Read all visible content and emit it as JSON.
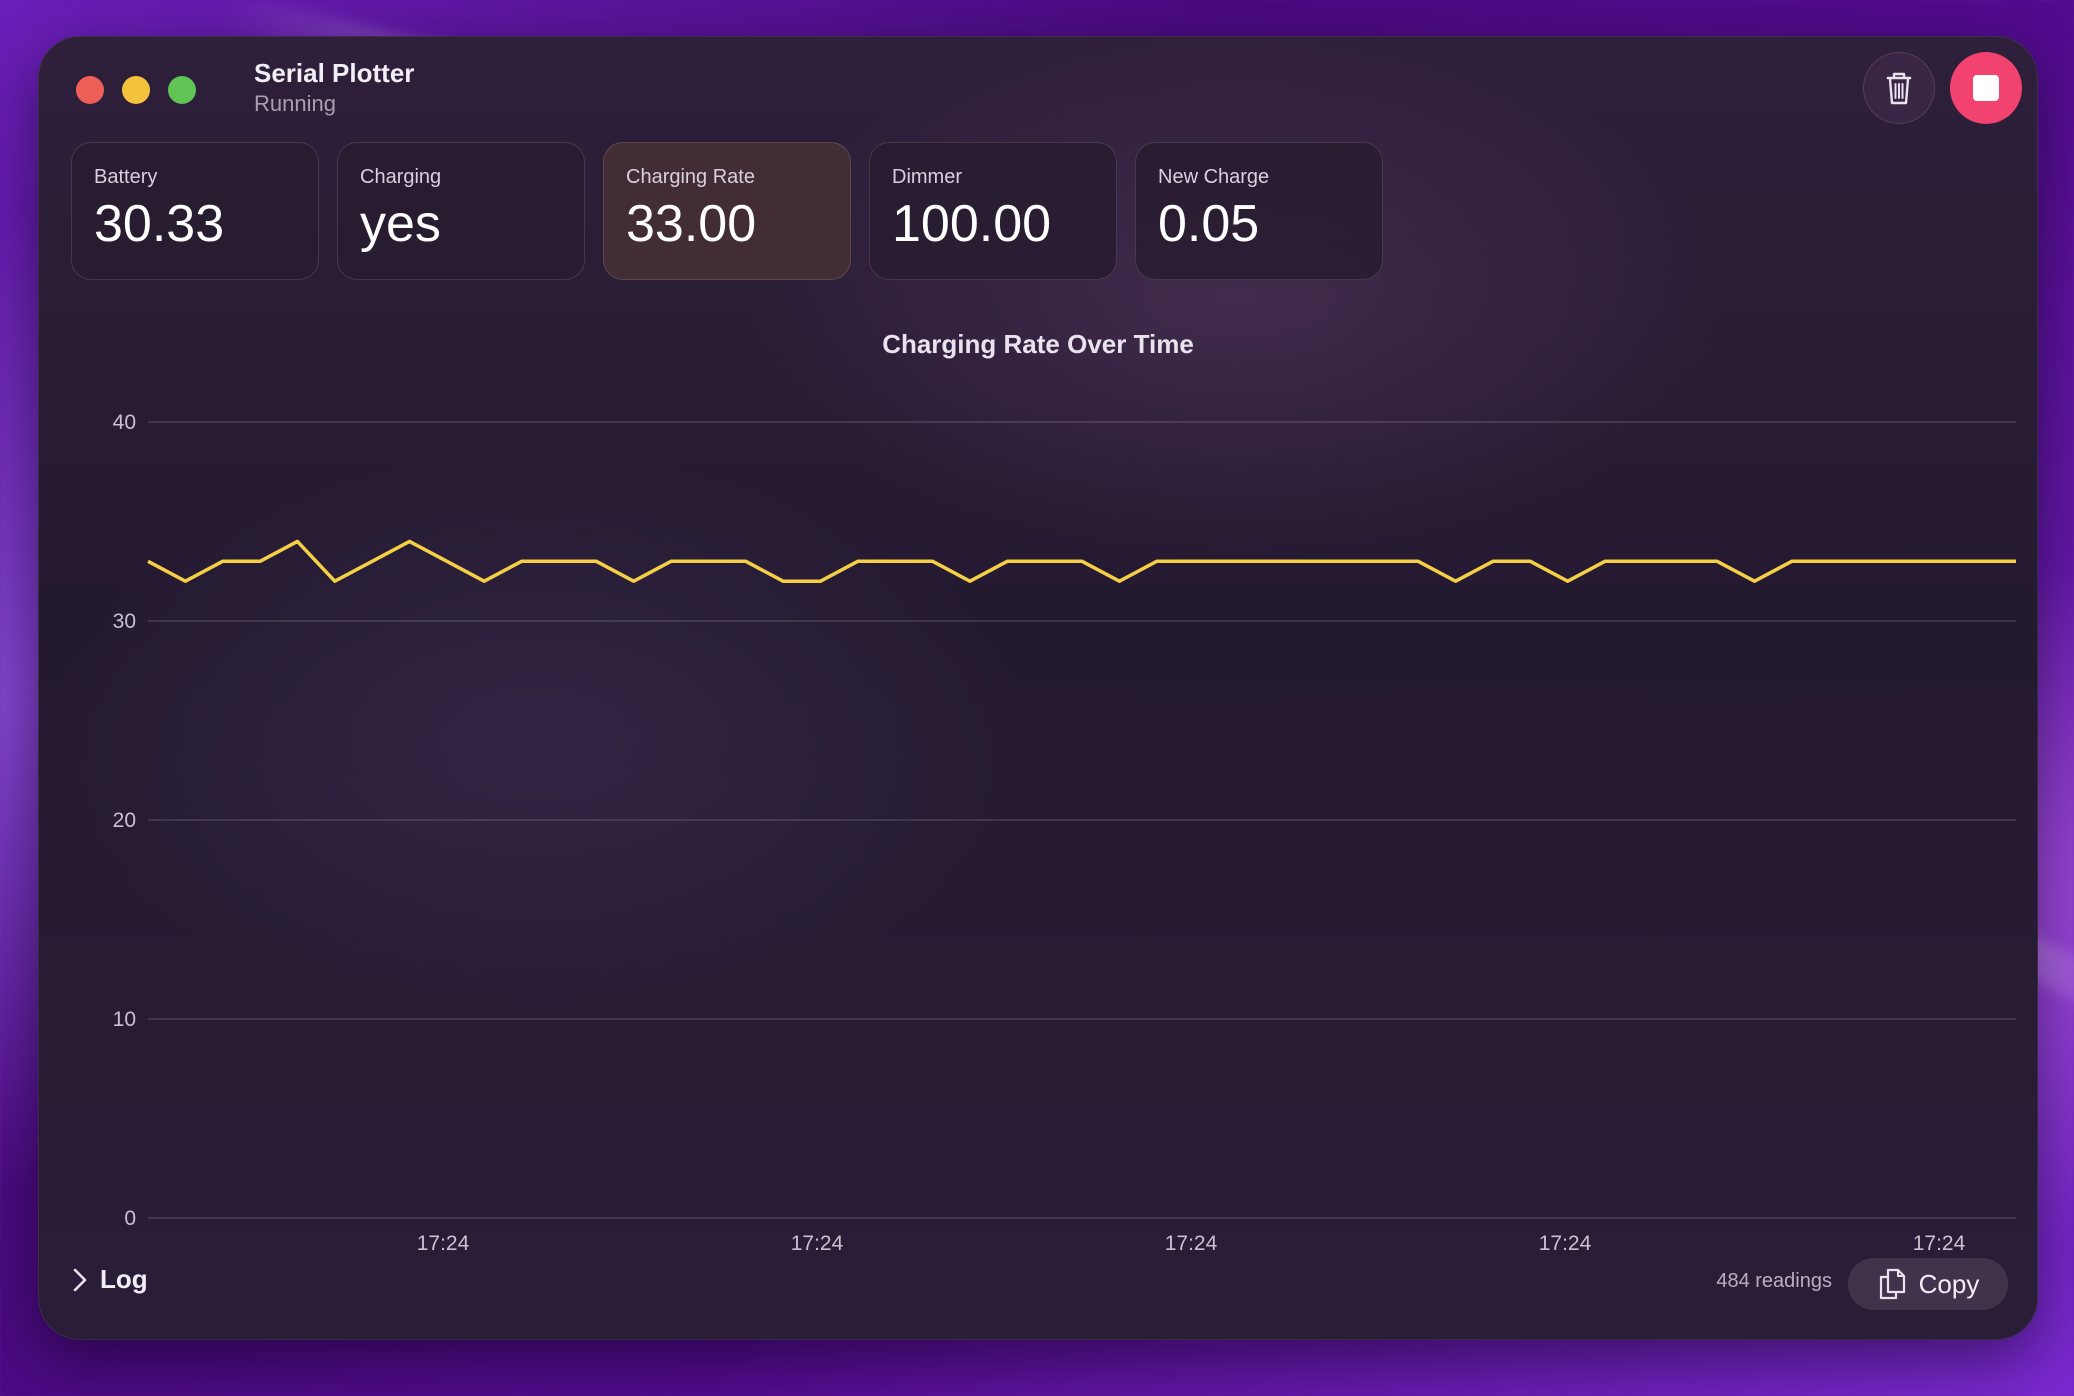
{
  "window": {
    "title": "Serial Plotter",
    "status": "Running"
  },
  "controls": {
    "clear_icon": "trash-icon",
    "stop_icon": "stop-icon",
    "stop_color": "#f2426f"
  },
  "cards": [
    {
      "label": "Battery",
      "value": "30.33"
    },
    {
      "label": "Charging",
      "value": "yes"
    },
    {
      "label": "Charging Rate",
      "value": "33.00",
      "selected": true
    },
    {
      "label": "Dimmer",
      "value": "100.00"
    },
    {
      "label": "New Charge",
      "value": "0.05"
    }
  ],
  "chart_data": {
    "type": "line",
    "title": "Charging Rate Over Time",
    "xlabel": "",
    "ylabel": "",
    "ylim": [
      0,
      40
    ],
    "yticks": [
      "0",
      "10",
      "20",
      "30",
      "40"
    ],
    "xticks": [
      "17:24",
      "17:24",
      "17:24",
      "17:24",
      "17:24"
    ],
    "grid": true,
    "line_color": "#f5cf45",
    "series": [
      {
        "values": [
          33,
          32,
          33,
          33,
          34,
          32,
          33,
          34,
          33,
          32,
          33,
          33,
          33,
          32,
          33,
          33,
          33,
          32,
          32,
          33,
          33,
          33,
          32,
          33,
          33,
          33,
          32,
          33,
          33,
          33,
          33,
          33,
          33,
          33,
          33,
          32,
          33,
          33,
          32,
          33,
          33,
          33,
          33,
          32,
          33,
          33,
          33,
          33,
          33,
          33,
          33
        ]
      }
    ]
  },
  "footer": {
    "log_label": "Log",
    "readings": "484 readings",
    "copy_label": "Copy",
    "copy_icon": "copy-icon"
  }
}
